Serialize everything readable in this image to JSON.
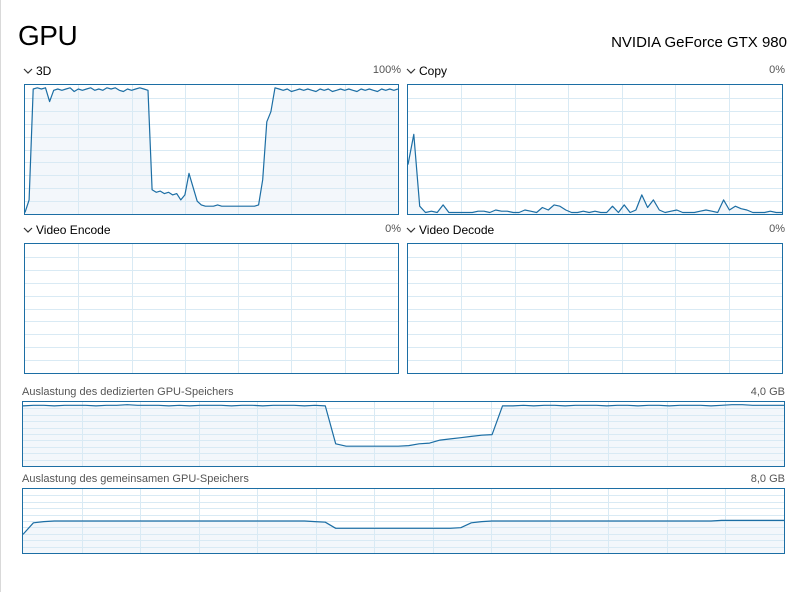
{
  "header": {
    "title": "GPU",
    "gpu_name": "NVIDIA GeForce GTX 980"
  },
  "engines": [
    {
      "label": "3D",
      "value": "100%",
      "series": [
        0,
        10,
        98,
        99,
        98,
        99,
        88,
        97,
        98,
        97,
        98,
        99,
        96,
        98,
        97,
        98,
        99,
        97,
        98,
        97,
        99,
        98,
        99,
        97,
        96,
        98,
        97,
        98,
        99,
        98,
        97,
        18,
        16,
        17,
        15,
        16,
        14,
        15,
        10,
        14,
        31,
        20,
        9,
        6,
        5,
        5,
        5,
        6,
        5,
        5,
        5,
        5,
        5,
        5,
        5,
        5,
        5,
        6,
        26,
        72,
        80,
        99,
        98,
        97,
        98,
        96,
        97,
        98,
        97,
        98,
        97,
        96,
        98,
        97,
        98,
        96,
        97,
        98,
        97,
        98,
        97,
        96,
        98,
        97,
        98,
        97,
        96,
        98,
        97,
        98,
        97,
        98
      ]
    },
    {
      "label": "Copy",
      "value": "0%",
      "series": [
        38,
        62,
        5,
        0,
        1,
        0,
        6,
        0,
        0,
        0,
        0,
        0,
        1,
        1,
        0,
        2,
        1,
        1,
        0,
        0,
        2,
        1,
        0,
        4,
        2,
        6,
        5,
        2,
        0,
        0,
        1,
        0,
        1,
        0,
        0,
        5,
        0,
        6,
        0,
        2,
        14,
        4,
        10,
        2,
        0,
        1,
        2,
        0,
        0,
        0,
        1,
        2,
        1,
        0,
        10,
        2,
        5,
        3,
        2,
        0,
        0,
        0,
        1,
        0,
        0
      ]
    },
    {
      "label": "Video Encode",
      "value": "0%",
      "series": []
    },
    {
      "label": "Video Decode",
      "value": "0%",
      "series": []
    }
  ],
  "memory": [
    {
      "label": "Auslastung des dedizierten GPU-Speichers",
      "value": "4,0 GB",
      "series": [
        96,
        97,
        97,
        96,
        97,
        97,
        97,
        96,
        97,
        97,
        98,
        97,
        97,
        97,
        96,
        97,
        96,
        97,
        97,
        97,
        96,
        97,
        97,
        96,
        97,
        97,
        97,
        96,
        97,
        96,
        34,
        30,
        30,
        30,
        30,
        30,
        30,
        31,
        34,
        35,
        40,
        42,
        44,
        46,
        48,
        49,
        96,
        96,
        97,
        96,
        97,
        97,
        96,
        97,
        97,
        97,
        96,
        97,
        97,
        96,
        97,
        97,
        96,
        97,
        97,
        97,
        96,
        97,
        98,
        98,
        97,
        97,
        97,
        97
      ]
    },
    {
      "label": "Auslastung des gemeinsamen GPU-Speichers",
      "value": "8,0 GB",
      "series": [
        28,
        47,
        49,
        50,
        50,
        50,
        50,
        50,
        50,
        50,
        50,
        50,
        50,
        50,
        50,
        50,
        50,
        50,
        50,
        50,
        50,
        50,
        50,
        50,
        50,
        50,
        50,
        50,
        49,
        48,
        38,
        38,
        38,
        38,
        38,
        38,
        38,
        38,
        38,
        38,
        38,
        38,
        39,
        47,
        49,
        50,
        50,
        50,
        50,
        50,
        50,
        50,
        50,
        50,
        50,
        50,
        50,
        50,
        50,
        50,
        50,
        50,
        50,
        50,
        50,
        50,
        50,
        51,
        51,
        51,
        51,
        51,
        51,
        51
      ]
    }
  ],
  "colors": {
    "line": "#1c6ea4",
    "fill": "#f1f6fa",
    "grid": "#d9eaf4",
    "border": "#1c6ea4"
  }
}
